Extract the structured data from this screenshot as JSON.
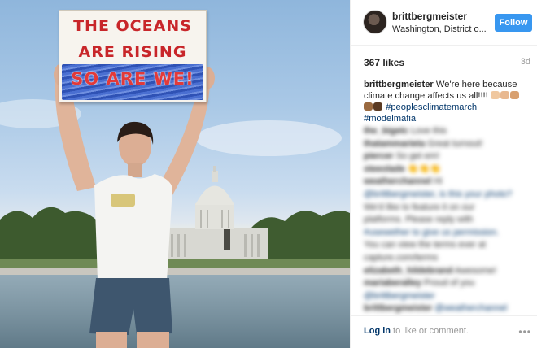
{
  "photo": {
    "sign": {
      "line1": "THE OCEANS",
      "line2": "ARE RISING",
      "line3": "SO ARE WE!"
    }
  },
  "post": {
    "username": "brittbergmeister",
    "location": "Washington, District o...",
    "follow_label": "Follow",
    "likes": "367 likes",
    "age": "3d",
    "caption": {
      "user": "brittbergmeister",
      "text": "We're here because climate change affects us all!!!!",
      "hashtag1": "#peoplesclimatemarch",
      "hashtag2": "#modelmafia"
    },
    "comments": [
      {
        "user": "the_bigetc",
        "text": "Love this"
      },
      {
        "user": "thatammarieta",
        "text": "Great turnout!"
      },
      {
        "user": "piercer",
        "text": "So get em!"
      },
      {
        "user": "steeolade",
        "text": "👏👏👏"
      },
      {
        "user": "weatherchannel",
        "text": "Hi"
      },
      {
        "user": "",
        "text": "@brittbergmeister, is this your photo?"
      },
      {
        "user": "",
        "text": "We'd like to feature it on our"
      },
      {
        "user": "",
        "text": "platforms. Please reply with"
      },
      {
        "user": "",
        "text": "#usewether to give us permission."
      },
      {
        "user": "",
        "text": "You can view the terms ever at"
      },
      {
        "user": "",
        "text": "capture.com/terms"
      },
      {
        "user": "elizabeth_hildebrand",
        "text": "Awesome!"
      },
      {
        "user": "mariaberalley",
        "text": "Proud of you"
      },
      {
        "user": "",
        "text": "@brittbergmeister"
      },
      {
        "user": "brittbergmeister",
        "text": "@weatherchannel"
      }
    ],
    "footer": {
      "login_link": "Log in",
      "login_rest": " to like or comment.",
      "more_icon": "•••"
    }
  },
  "colors": {
    "follow_button": "#3897f0",
    "link": "#003569",
    "muted": "#999999"
  }
}
